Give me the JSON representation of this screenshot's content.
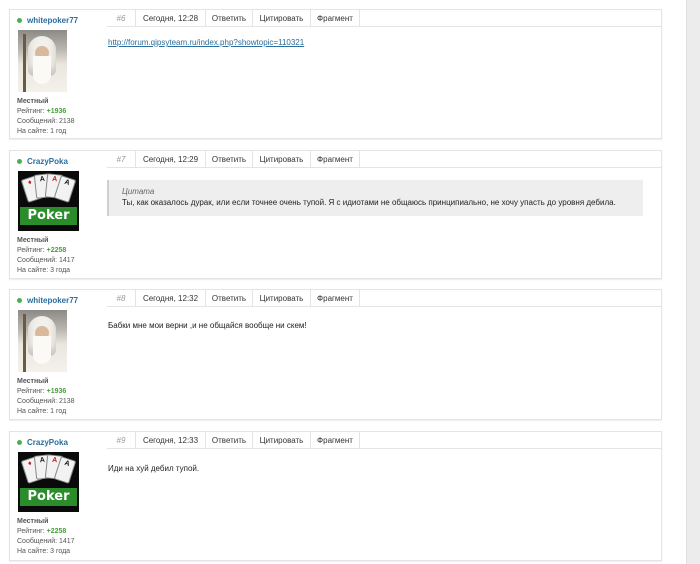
{
  "posts": [
    {
      "author": "whitepoker77",
      "rank": "Местный",
      "rating_label": "Рейтинг:",
      "rating": "+1936",
      "messages": "Сообщений: 2138",
      "onsite": "На сайте: 1 год",
      "number": "#6",
      "date": "Сегодня, 12:28",
      "content_link": "http://forum.qipsyteam.ru/index.php?showtopic=110321"
    },
    {
      "author": "CrazyPoka",
      "rank": "Местный",
      "rating_label": "Рейтинг:",
      "rating": "+2258",
      "messages": "Сообщений: 1417",
      "onsite": "На сайте: 3 года",
      "number": "#7",
      "date": "Сегодня, 12:29",
      "quote_title": "Цитата",
      "quote_text": "Ты, как оказалось дурак, или если точнее очень тупой. Я с идиотами не общаюсь принципиально, не хочу упасть до уровня дебила."
    },
    {
      "author": "whitepoker77",
      "rank": "Местный",
      "rating_label": "Рейтинг:",
      "rating": "+1936",
      "messages": "Сообщений: 2138",
      "onsite": "На сайте: 1 год",
      "number": "#8",
      "date": "Сегодня, 12:32",
      "content": "Бабки мне мои верни ,и не общайся вообще ни скем!"
    },
    {
      "author": "CrazyPoka",
      "rank": "Местный",
      "rating_label": "Рейтинг:",
      "rating": "+2258",
      "messages": "Сообщений: 1417",
      "onsite": "На сайте: 3 года",
      "number": "#9",
      "date": "Сегодня, 12:33",
      "content": "Иди на хуй дебил тупой."
    }
  ],
  "actions": {
    "reply": "Ответить",
    "quote": "Цитировать",
    "fragment": "Фрагмент"
  },
  "avatar_poker_word": "Poker",
  "card_suits": [
    "♦",
    "A",
    "A",
    "A"
  ],
  "colors": {
    "author_name": "#2b6d9e",
    "online_dot": "#4caf50",
    "rating": "#4a9e3d"
  }
}
